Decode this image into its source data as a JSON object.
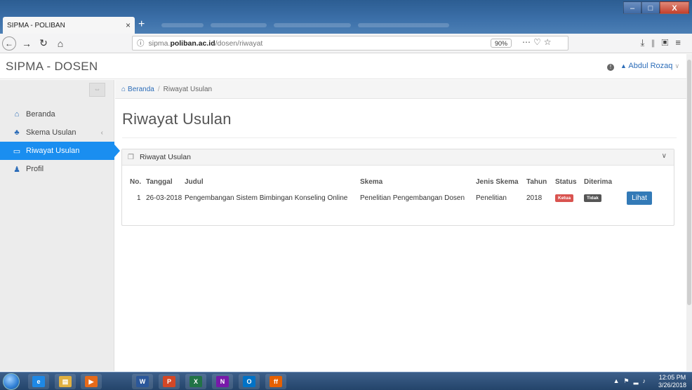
{
  "browser": {
    "tab_title": "SIPMA - POLIBAN",
    "tab_close": "×",
    "new_tab": "+",
    "url_host": "sipma.poliban.ac.id",
    "url_prefix": "sipma.",
    "url_domain": "poliban.ac.id",
    "url_path": "/dosen/riwayat",
    "zoom": "90%",
    "window_min": "–",
    "window_max": "□",
    "window_close": "X"
  },
  "header": {
    "brand": "SIPMA - DOSEN",
    "user_name": "Abdul Rozaq",
    "alert_glyph": "!"
  },
  "sidebar": {
    "items": [
      {
        "label": "Beranda",
        "icon": "home-icon"
      },
      {
        "label": "Skema Usulan",
        "icon": "sitemap-icon"
      },
      {
        "label": "Riwayat Usulan",
        "icon": "folder-icon"
      },
      {
        "label": "Profil",
        "icon": "users-icon"
      }
    ]
  },
  "breadcrumb": {
    "home": "Beranda",
    "separator": "/",
    "current": "Riwayat Usulan"
  },
  "page": {
    "title": "Riwayat Usulan"
  },
  "panel": {
    "title": "Riwayat Usulan",
    "columns": [
      "No.",
      "Tanggal",
      "Judul",
      "Skema",
      "Jenis Skema",
      "Tahun",
      "Status",
      "Diterima"
    ],
    "rows": [
      {
        "no": "1",
        "tanggal": "26-03-2018",
        "judul": "Pengembangan Sistem Bimbingan Konseling Online",
        "skema": "Penelitian Pengembangan Dosen",
        "jenis": "Penelitian",
        "tahun": "2018",
        "status": "Ketua",
        "diterima": "Tidak",
        "action": "Lihat"
      }
    ]
  },
  "taskbar": {
    "apps": [
      {
        "name": "ie",
        "glyph": "e",
        "color": "#1e88e5"
      },
      {
        "name": "explorer",
        "glyph": "▤",
        "color": "#e0b040"
      },
      {
        "name": "media",
        "glyph": "▶",
        "color": "#e66a1a"
      },
      {
        "name": "word",
        "glyph": "W",
        "color": "#2b579a"
      },
      {
        "name": "powerpoint",
        "glyph": "P",
        "color": "#d24726"
      },
      {
        "name": "excel",
        "glyph": "X",
        "color": "#217346"
      },
      {
        "name": "onenote",
        "glyph": "N",
        "color": "#7719aa"
      },
      {
        "name": "outlook",
        "glyph": "O",
        "color": "#0072c6"
      },
      {
        "name": "firefox",
        "glyph": "ff",
        "color": "#e66000"
      }
    ],
    "time": "12:05 PM",
    "date": "3/26/2018"
  },
  "colors": {
    "accent": "#1a8ef0",
    "link": "#2b6cb8",
    "badge_status": "#d9534f",
    "badge_diterima": "#555555",
    "button": "#337ab7"
  }
}
